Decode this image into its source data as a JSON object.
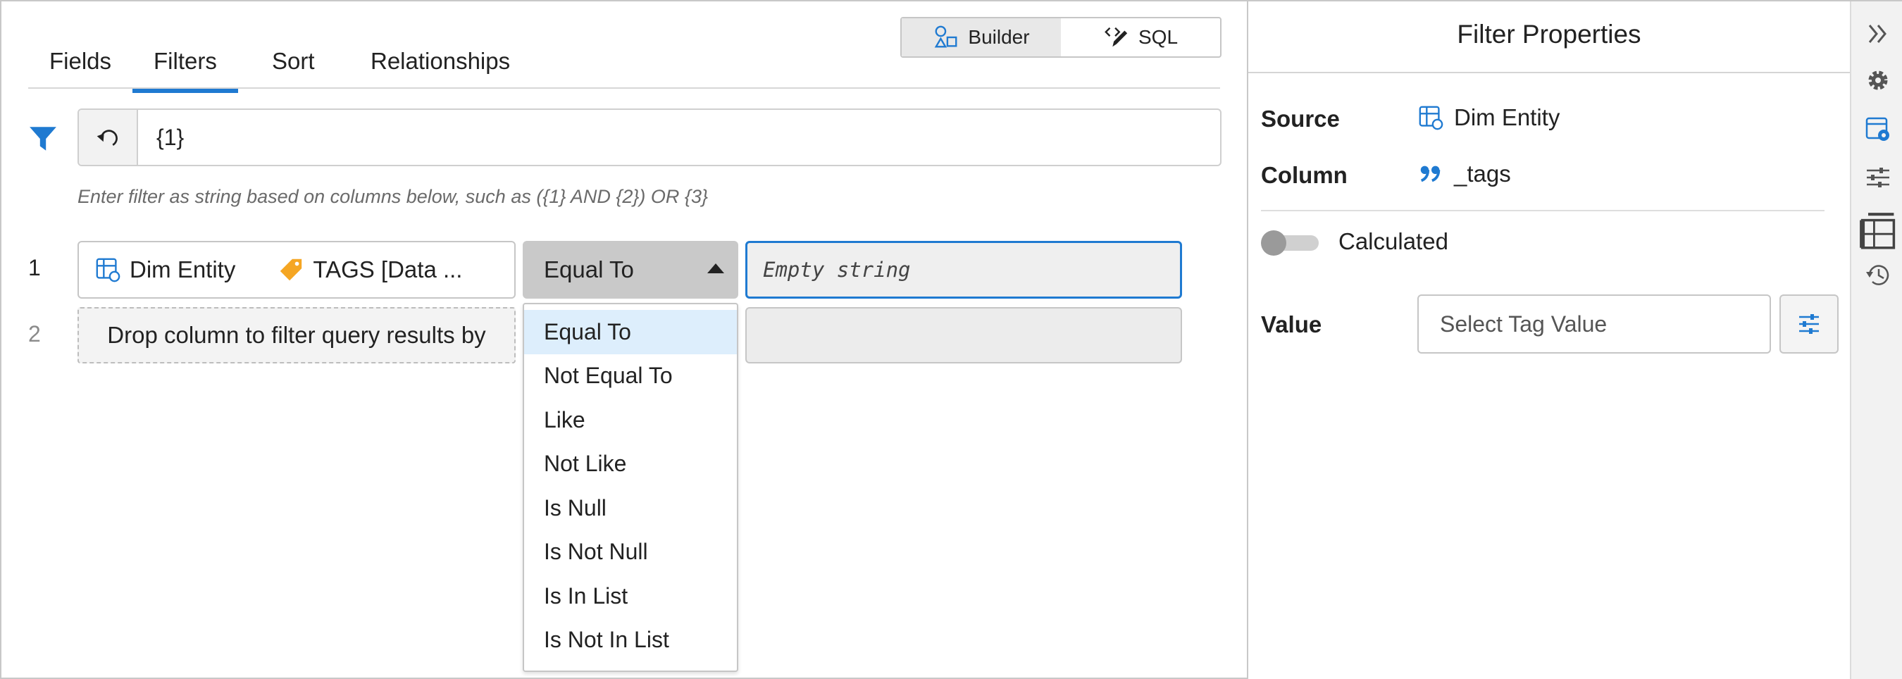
{
  "tabs": [
    {
      "label": "Fields"
    },
    {
      "label": "Filters"
    },
    {
      "label": "Sort"
    },
    {
      "label": "Relationships"
    }
  ],
  "mode_toggle": {
    "builder_label": "Builder",
    "sql_label": "SQL",
    "active": "Builder"
  },
  "filter_expression": {
    "value": "{1}",
    "hint": "Enter filter as string based on columns below, such as ({1} AND {2}) OR {3}"
  },
  "filter_rows": [
    {
      "number": "1",
      "entity": "Dim Entity",
      "column": "TAGS [Data ...",
      "operator": "Equal To",
      "value_placeholder": "Empty string"
    },
    {
      "number": "2",
      "drop_text": "Drop column to filter query results by"
    }
  ],
  "operator_options": [
    "Equal To",
    "Not Equal To",
    "Like",
    "Not Like",
    "Is Null",
    "Is Not Null",
    "Is In List",
    "Is Not In List"
  ],
  "operator_selected": "Equal To",
  "properties": {
    "title": "Filter Properties",
    "source_label": "Source",
    "source_value": "Dim Entity",
    "column_label": "Column",
    "column_value": "_tags",
    "calculated_label": "Calculated",
    "calculated_on": false,
    "value_label": "Value",
    "value_placeholder": "Select Tag Value"
  },
  "rail": [
    "collapse-icon",
    "gear-icon",
    "filter-settings-icon",
    "sliders-icon",
    "table-icon",
    "history-icon"
  ],
  "colors": {
    "accent": "#1f7ad1",
    "tag_orange": "#f5a623"
  }
}
